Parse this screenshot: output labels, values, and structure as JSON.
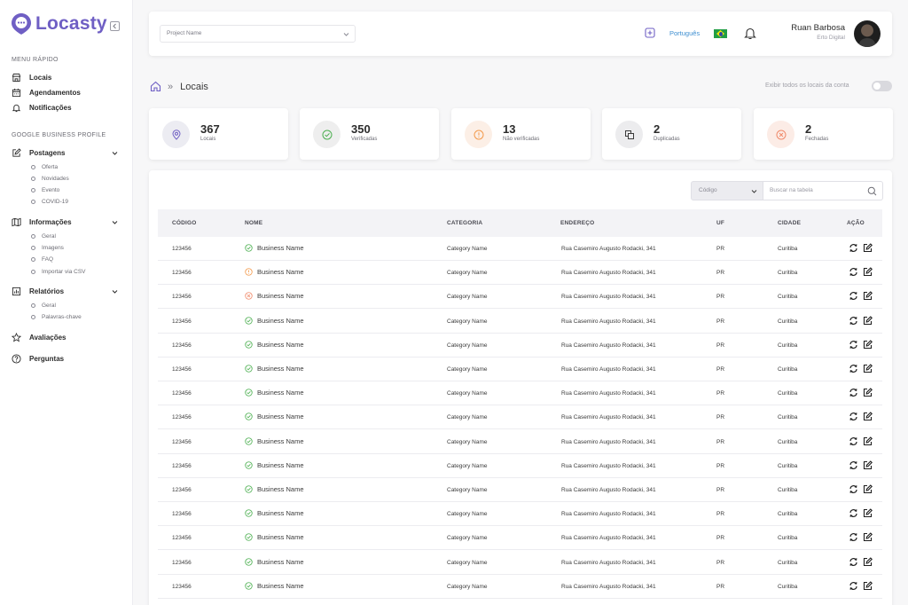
{
  "brand": {
    "name": "Locasty",
    "color": "#6f5fc4"
  },
  "sidebar": {
    "quick_menu_title": "MENU RÁPIDO",
    "quick_items": [
      {
        "label": "Locais",
        "icon": "store-icon"
      },
      {
        "label": "Agendamentos",
        "icon": "calendar-icon"
      },
      {
        "label": "Notificações",
        "icon": "bell-icon"
      }
    ],
    "gbp_title": "GOOGLE BUSINESS PROFILE",
    "groups": [
      {
        "label": "Postagens",
        "icon": "edit-icon",
        "expanded": true,
        "subitems": [
          "Oferta",
          "Novidades",
          "Evento",
          "COVID-19"
        ]
      },
      {
        "label": "Informações",
        "icon": "map-icon",
        "expanded": true,
        "subitems": [
          "Geral",
          "Imagens",
          "FAQ",
          "Importar via CSV"
        ]
      },
      {
        "label": "Relatórios",
        "icon": "chart-icon",
        "expanded": true,
        "subitems": [
          "Geral",
          "Palavras-chave"
        ]
      }
    ],
    "bottom_items": [
      {
        "label": "Avaliações",
        "icon": "star-icon"
      },
      {
        "label": "Perguntas",
        "icon": "question-icon"
      }
    ]
  },
  "topbar": {
    "project_placeholder": "Project Name",
    "language": "Português",
    "user_name": "Ruan Barbosa",
    "user_company": "Erto Digital"
  },
  "breadcrumb": {
    "current": "Locais",
    "separator": "»"
  },
  "toggle_label": "Exibir todos os locais da conta",
  "stats": [
    {
      "value": "367",
      "label": "Locais",
      "icon": "location-pin-icon",
      "color": "#6f5fc4",
      "bg": "#ececf2"
    },
    {
      "value": "350",
      "label": "Verificadas",
      "icon": "check-circle-icon",
      "color": "#4caf50",
      "bg": "#eeeeee"
    },
    {
      "value": "13",
      "label": "Não verificadas",
      "icon": "alert-circle-icon",
      "color": "#f39a4c",
      "bg": "#fcefe6"
    },
    {
      "value": "2",
      "label": "Duplicadas",
      "icon": "copy-icon",
      "color": "#3a3a3a",
      "bg": "#ececee"
    },
    {
      "value": "2",
      "label": "Fechadas",
      "icon": "x-circle-icon",
      "color": "#f08a6a",
      "bg": "#fcece6"
    }
  ],
  "filters": {
    "field": "Código",
    "search_placeholder": "Buscar na tabela"
  },
  "table": {
    "columns": [
      "CÓDIGO",
      "NOME",
      "CATEGORIA",
      "ENDEREÇO",
      "UF",
      "CIDADE",
      "AÇÃO"
    ],
    "rows": [
      {
        "code": "123456",
        "name": "Business Name",
        "status": "verified",
        "category": "Category Name",
        "address": "Rua Casemiro Augusto Rodacki, 341",
        "uf": "PR",
        "city": "Curitiba"
      },
      {
        "code": "123456",
        "name": "Business Name",
        "status": "unverified",
        "category": "Category Name",
        "address": "Rua Casemiro Augusto Rodacki, 341",
        "uf": "PR",
        "city": "Curitiba"
      },
      {
        "code": "123456",
        "name": "Business Name",
        "status": "closed",
        "category": "Category Name",
        "address": "Rua Casemiro Augusto Rodacki, 341",
        "uf": "PR",
        "city": "Curitiba"
      },
      {
        "code": "123456",
        "name": "Business Name",
        "status": "verified",
        "category": "Category Name",
        "address": "Rua Casemiro Augusto Rodacki, 341",
        "uf": "PR",
        "city": "Curitiba"
      },
      {
        "code": "123456",
        "name": "Business Name",
        "status": "verified",
        "category": "Category Name",
        "address": "Rua Casemiro Augusto Rodacki, 341",
        "uf": "PR",
        "city": "Curitiba"
      },
      {
        "code": "123456",
        "name": "Business Name",
        "status": "verified",
        "category": "Category Name",
        "address": "Rua Casemiro Augusto Rodacki, 341",
        "uf": "PR",
        "city": "Curitiba"
      },
      {
        "code": "123456",
        "name": "Business Name",
        "status": "verified",
        "category": "Category Name",
        "address": "Rua Casemiro Augusto Rodacki, 341",
        "uf": "PR",
        "city": "Curitiba"
      },
      {
        "code": "123456",
        "name": "Business Name",
        "status": "verified",
        "category": "Category Name",
        "address": "Rua Casemiro Augusto Rodacki, 341",
        "uf": "PR",
        "city": "Curitiba"
      },
      {
        "code": "123456",
        "name": "Business Name",
        "status": "verified",
        "category": "Category Name",
        "address": "Rua Casemiro Augusto Rodacki, 341",
        "uf": "PR",
        "city": "Curitiba"
      },
      {
        "code": "123456",
        "name": "Business Name",
        "status": "verified",
        "category": "Category Name",
        "address": "Rua Casemiro Augusto Rodacki, 341",
        "uf": "PR",
        "city": "Curitiba"
      },
      {
        "code": "123456",
        "name": "Business Name",
        "status": "verified",
        "category": "Category Name",
        "address": "Rua Casemiro Augusto Rodacki, 341",
        "uf": "PR",
        "city": "Curitiba"
      },
      {
        "code": "123456",
        "name": "Business Name",
        "status": "verified",
        "category": "Category Name",
        "address": "Rua Casemiro Augusto Rodacki, 341",
        "uf": "PR",
        "city": "Curitiba"
      },
      {
        "code": "123456",
        "name": "Business Name",
        "status": "verified",
        "category": "Category Name",
        "address": "Rua Casemiro Augusto Rodacki, 341",
        "uf": "PR",
        "city": "Curitiba"
      },
      {
        "code": "123456",
        "name": "Business Name",
        "status": "verified",
        "category": "Category Name",
        "address": "Rua Casemiro Augusto Rodacki, 341",
        "uf": "PR",
        "city": "Curitiba"
      },
      {
        "code": "123456",
        "name": "Business Name",
        "status": "verified",
        "category": "Category Name",
        "address": "Rua Casemiro Augusto Rodacki, 341",
        "uf": "PR",
        "city": "Curitiba"
      }
    ]
  },
  "status_colors": {
    "verified": "#4caf50",
    "unverified": "#f39a4c",
    "closed": "#f08a6a"
  }
}
